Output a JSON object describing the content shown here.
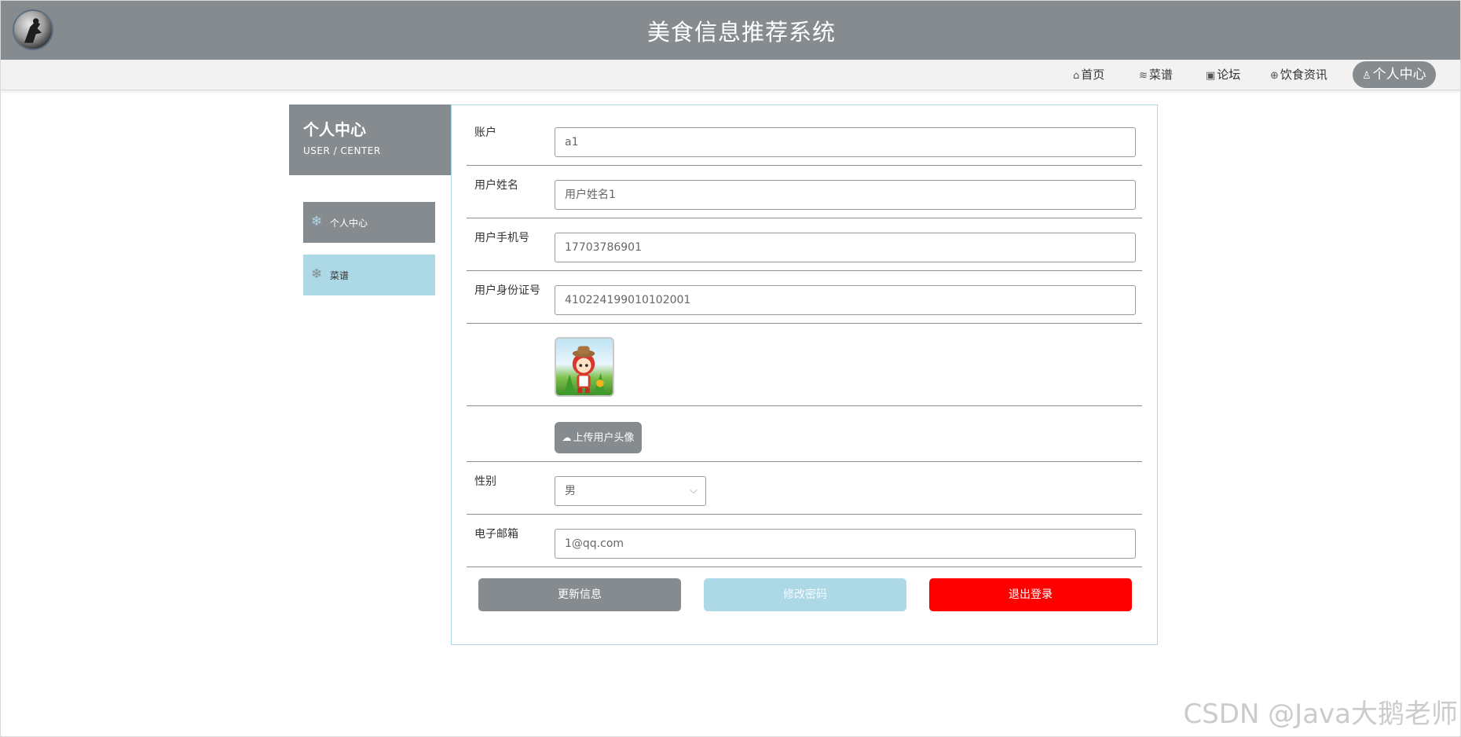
{
  "header": {
    "title": "美食信息推荐系统"
  },
  "nav": {
    "items": [
      {
        "icon": "home-icon",
        "label": "首页"
      },
      {
        "icon": "layers-icon",
        "label": "菜谱"
      },
      {
        "icon": "gift-icon",
        "label": "论坛"
      },
      {
        "icon": "globe-icon",
        "label": "饮食资讯"
      },
      {
        "icon": "user-icon",
        "label": "个人中心",
        "active": true
      }
    ]
  },
  "sidebar": {
    "title": "个人中心",
    "subtitle": "USER / CENTER",
    "items": [
      {
        "icon": "snowflake-icon",
        "label": "个人中心",
        "active": true
      },
      {
        "icon": "snowflake-icon",
        "label": "菜谱"
      }
    ]
  },
  "form": {
    "account": {
      "label": "账户",
      "value": "a1"
    },
    "name": {
      "label": "用户姓名",
      "value": "用户姓名1"
    },
    "phone": {
      "label": "用户手机号",
      "value": "17703786901"
    },
    "id_card": {
      "label": "用户身份证号",
      "value": "410224199010102001"
    },
    "upload_label": "上传用户头像",
    "gender": {
      "label": "性别",
      "value": "男"
    },
    "email": {
      "label": "电子邮箱",
      "value": "1@qq.com"
    }
  },
  "buttons": {
    "update": "更新信息",
    "change_password": "修改密码",
    "logout": "退出登录"
  },
  "watermark": "CSDN @Java大鹅老师",
  "colors": {
    "primary": "#858b8f",
    "accent": "#add8e6",
    "danger": "#ff0000"
  }
}
